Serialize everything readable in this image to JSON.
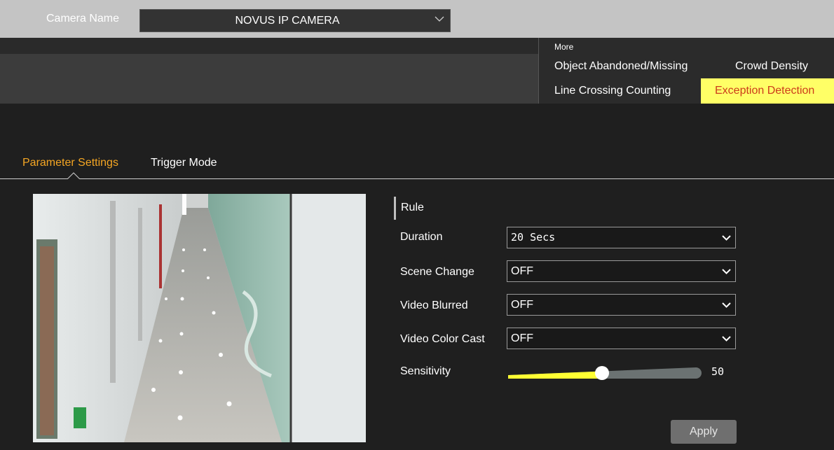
{
  "header": {
    "camera_label": "Camera Name",
    "camera_value": "NOVUS IP CAMERA"
  },
  "more_panel": {
    "title": "More",
    "items": [
      {
        "label": "Object Abandoned/Missing",
        "active": false
      },
      {
        "label": "Crowd Density",
        "active": false
      },
      {
        "label": "Line Crossing Counting",
        "active": false
      },
      {
        "label": "Exception Detection",
        "active": true
      }
    ]
  },
  "tabs": [
    {
      "label": "Parameter Settings",
      "active": true
    },
    {
      "label": "Trigger Mode",
      "active": false
    }
  ],
  "rule": {
    "section_label": "Rule",
    "fields": [
      {
        "label": "Duration",
        "value": "20 Secs"
      },
      {
        "label": "Scene Change",
        "value": "OFF"
      },
      {
        "label": "Video Blurred",
        "value": "OFF"
      },
      {
        "label": "Video Color Cast",
        "value": "OFF"
      }
    ],
    "sensitivity": {
      "label": "Sensitivity",
      "value": "50",
      "level": 50
    }
  },
  "actions": {
    "apply_label": "Apply"
  },
  "colors": {
    "accent_tab": "#f5a623",
    "active_item_bg": "#ffff66",
    "active_item_text": "#cc3b1a",
    "slider_fill": "#ffff33"
  }
}
